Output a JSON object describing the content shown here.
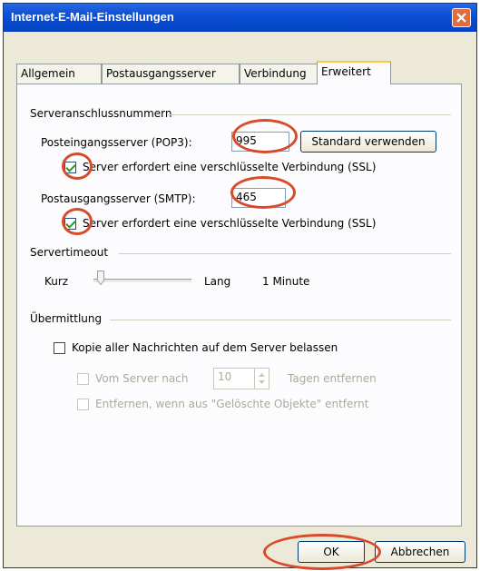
{
  "window": {
    "title": "Internet-E-Mail-Einstellungen"
  },
  "tabs": [
    {
      "label": "Allgemein",
      "active": false
    },
    {
      "label": "Postausgangsserver",
      "active": false
    },
    {
      "label": "Verbindung",
      "active": false
    },
    {
      "label": "Erweitert",
      "active": true
    }
  ],
  "server_ports": {
    "section_label": "Serveranschlussnummern",
    "incoming_label": "Posteingangsserver (POP3):",
    "incoming_value": "995",
    "default_button": "Standard verwenden",
    "incoming_ssl_label": "Server erfordert eine verschlüsselte Verbindung (SSL)",
    "incoming_ssl_checked": true,
    "outgoing_label": "Postausgangsserver (SMTP):",
    "outgoing_value": "465",
    "outgoing_ssl_label": "Server erfordert eine verschlüsselte Verbindung (SSL)",
    "outgoing_ssl_checked": true
  },
  "timeout": {
    "section_label": "Servertimeout",
    "short_label": "Kurz",
    "long_label": "Lang",
    "value_text": "1 Minute"
  },
  "delivery": {
    "section_label": "Übermittlung",
    "keep_copy_label": "Kopie aller Nachrichten auf dem Server belassen",
    "keep_copy_checked": false,
    "remove_after_label": "Vom Server nach",
    "remove_after_value": "10",
    "remove_after_suffix": "Tagen entfernen",
    "remove_deleted_label": "Entfernen, wenn aus \"Gelöschte Objekte\" entfernt"
  },
  "footer": {
    "ok_button": "OK",
    "cancel_button": "Abbrechen"
  },
  "colors": {
    "titlebar": "#0a4fd6",
    "annotation_red": "#d84a2a",
    "dialog_bg": "#ece9d8"
  }
}
